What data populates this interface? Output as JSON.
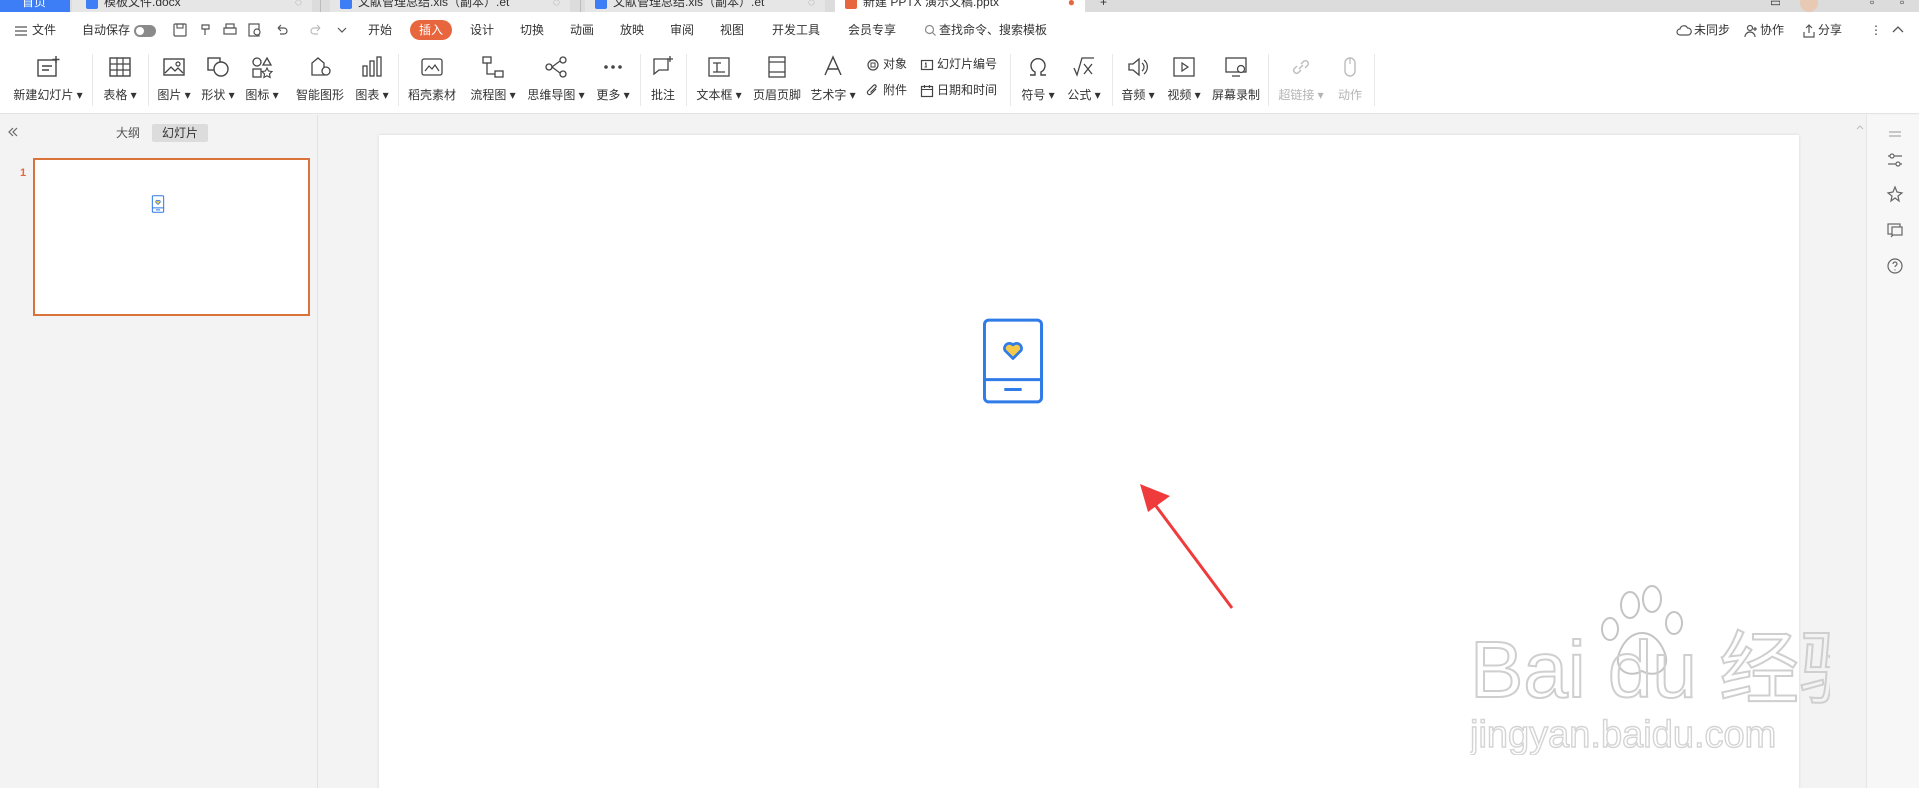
{
  "tabs": [
    {
      "label": "首页"
    },
    {
      "label": "模板文件.docx"
    },
    {
      "label": "文献管理总结.xls（副本）.et"
    },
    {
      "label": "文献管理总结.xls（副本）.et"
    },
    {
      "label": "新建 PPTX 演示文稿.pptx"
    }
  ],
  "menu": {
    "file": "文件",
    "autosave": "自动保存",
    "tabs": [
      "开始",
      "插入",
      "设计",
      "切换",
      "动画",
      "放映",
      "审阅",
      "视图",
      "开发工具",
      "会员专享"
    ],
    "active_tab": "插入",
    "search_placeholder": "查找命令、搜索模板",
    "sync": "未同步",
    "collab": "协作",
    "share": "分享"
  },
  "ribbon": {
    "new_slide": "新建幻灯片",
    "table": "表格",
    "picture": "图片",
    "shape": "形状",
    "icon": "图标",
    "smart_graphic": "智能图形",
    "chart": "图表",
    "daoke": "稻壳素材",
    "flowchart": "流程图",
    "mindmap": "思维导图",
    "more": "更多",
    "comment": "批注",
    "textbox": "文本框",
    "header_footer": "页眉页脚",
    "wordart": "艺术字",
    "object": "对象",
    "slide_number": "幻灯片编号",
    "attachment": "附件",
    "date_time": "日期和时间",
    "symbol": "符号",
    "formula": "公式",
    "audio": "音频",
    "video": "视频",
    "screen_record": "屏幕录制",
    "hyperlink": "超链接",
    "action": "动作"
  },
  "panel": {
    "outline_tab": "大纲",
    "slides_tab": "幻灯片",
    "slide_number": "1"
  },
  "colors": {
    "accent_orange": "#e8663e",
    "icon_blue": "#2f7be8",
    "heart_yellow": "#f7c948",
    "arrow_red": "#ef3b3b"
  },
  "watermark": {
    "brand": "Bai du 经验",
    "url": "jingyan.baidu.com"
  }
}
